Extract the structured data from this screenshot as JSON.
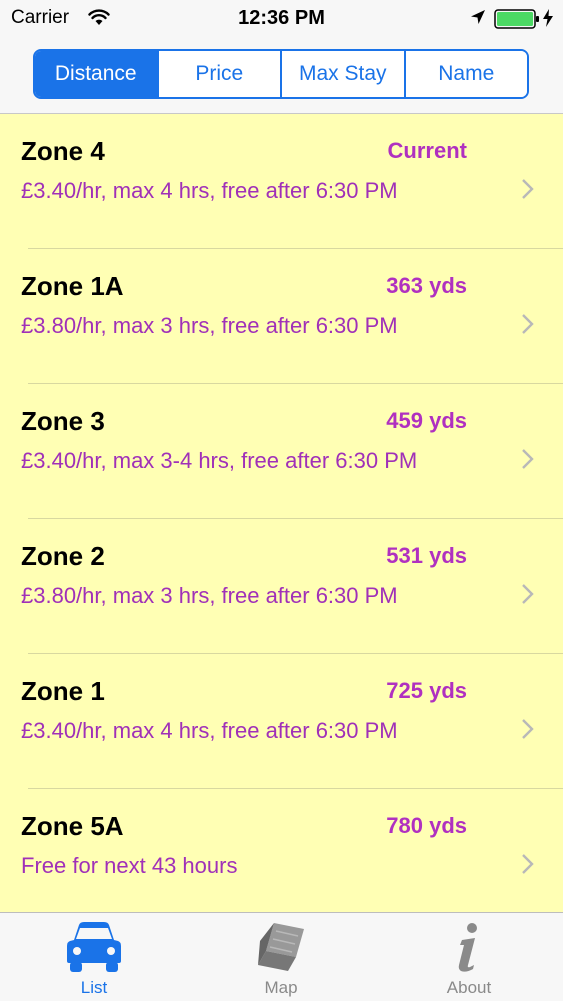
{
  "status": {
    "carrier": "Carrier",
    "time": "12:36 PM",
    "battery_color": "#4cd964"
  },
  "segments": [
    {
      "label": "Distance",
      "selected": true
    },
    {
      "label": "Price",
      "selected": false
    },
    {
      "label": "Max Stay",
      "selected": false
    },
    {
      "label": "Name",
      "selected": false
    }
  ],
  "zones": [
    {
      "name": "Zone 4",
      "distance": "Current",
      "detail": "£3.40/hr, max 4 hrs, free after 6:30 PM"
    },
    {
      "name": "Zone 1A",
      "distance": "363 yds",
      "detail": "£3.80/hr, max 3 hrs, free after 6:30 PM"
    },
    {
      "name": "Zone 3",
      "distance": "459 yds",
      "detail": "£3.40/hr, max 3-4 hrs, free after 6:30 PM"
    },
    {
      "name": "Zone 2",
      "distance": "531 yds",
      "detail": "£3.80/hr, max 3 hrs, free after 6:30 PM"
    },
    {
      "name": "Zone 1",
      "distance": "725 yds",
      "detail": "£3.40/hr, max 4 hrs, free after 6:30 PM"
    },
    {
      "name": "Zone 5A",
      "distance": "780 yds",
      "detail": "Free for next 43 hours"
    }
  ],
  "tabs": [
    {
      "label": "List",
      "icon": "car-icon",
      "selected": true
    },
    {
      "label": "Map",
      "icon": "map-icon",
      "selected": false
    },
    {
      "label": "About",
      "icon": "info-icon",
      "selected": false
    }
  ],
  "colors": {
    "accent": "#1a73e8",
    "list_background": "#ffffb4",
    "distance_text": "#b030c0",
    "detail_text": "#a030b8"
  }
}
